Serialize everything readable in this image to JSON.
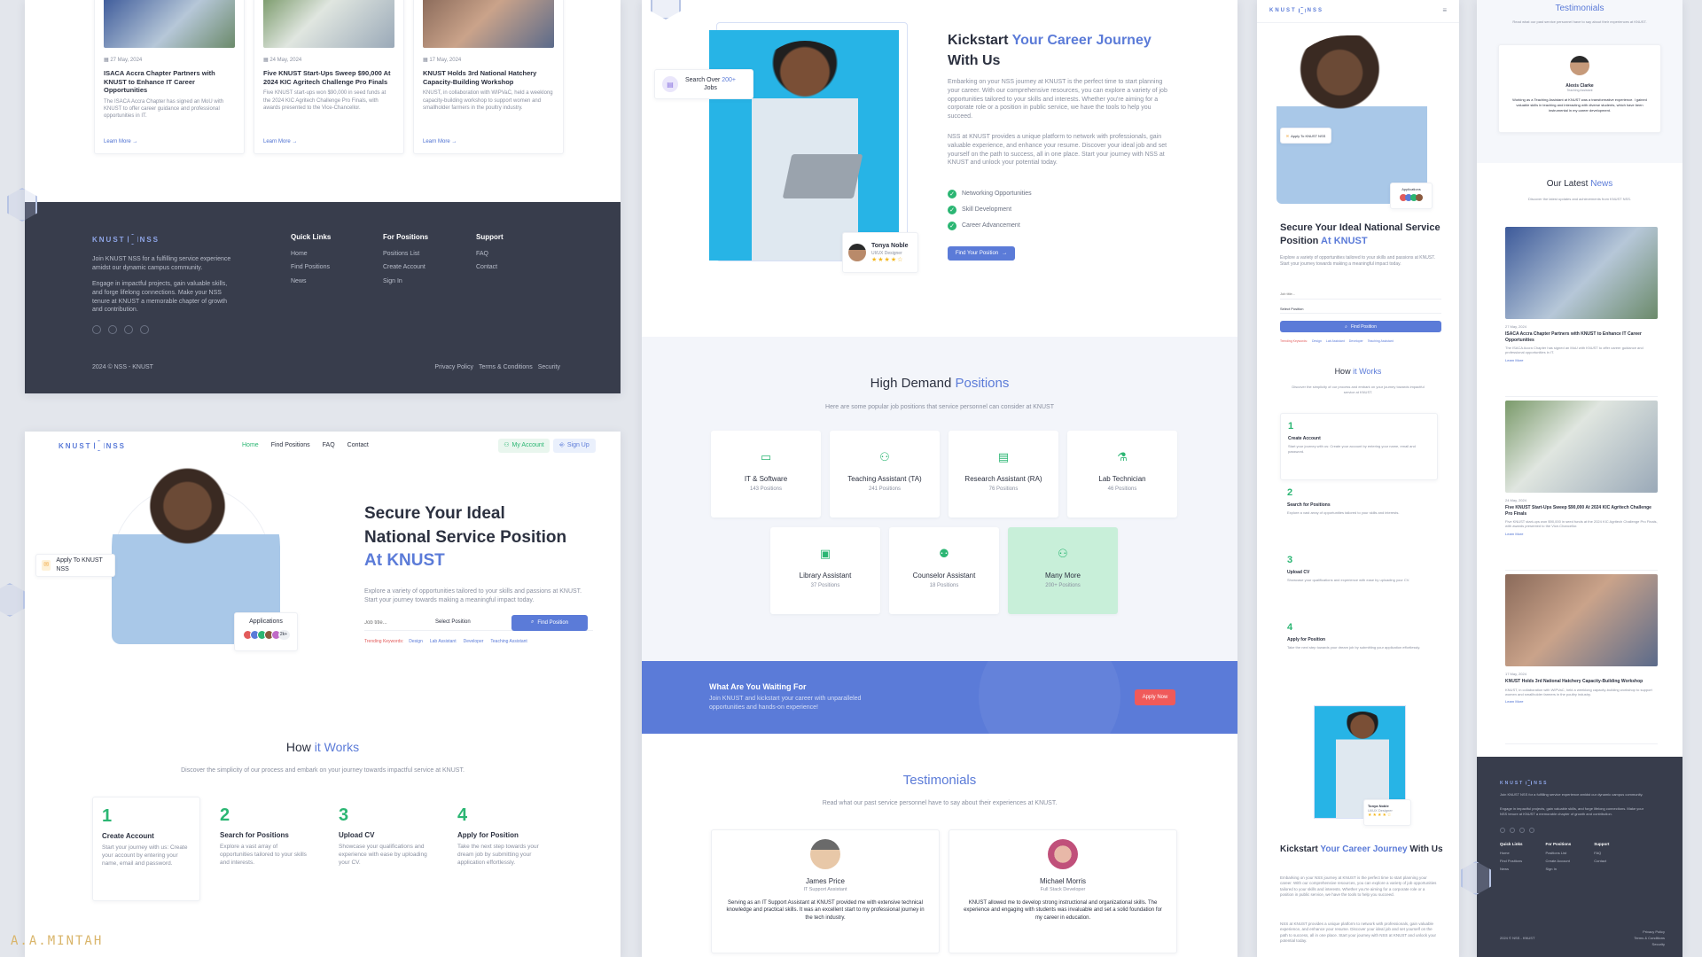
{
  "watermark": "A.A.MINTAH",
  "icons": {
    "calendar": "calendar-icon",
    "arrow": "arrow-right-icon",
    "search": "search-icon",
    "check": "check-icon",
    "star": "star-icon"
  },
  "colors": {
    "accent": "#5b7bd8",
    "footer": "#383d4c",
    "green": "#2bb673",
    "cta": "#5b7bd8",
    "apply_btn": "#f05a5a"
  },
  "news": {
    "title_plain": "Our Latest ",
    "title_accent": "News",
    "subtitle": "Discover the latest updates and achievements from KNUST NSS.",
    "read_more": "Learn More",
    "items": [
      {
        "date": "27 May, 2024",
        "title": "ISACA Accra Chapter Partners with KNUST to Enhance IT Career Opportunities",
        "excerpt": "The ISACA Accra Chapter has signed an MoU with KNUST to offer career guidance and professional opportunities in IT."
      },
      {
        "date": "24 May, 2024",
        "title": "Five KNUST Start-Ups Sweep $90,000 At 2024 KIC Agritech Challenge Pro Finals",
        "excerpt": "Five KNUST start-ups won $90,000 in seed funds at the 2024 KIC Agritech Challenge Pro Finals, with awards presented to the Vice-Chancellor."
      },
      {
        "date": "17 May, 2024",
        "title": "KNUST Holds 3rd National Hatchery Capacity-Building Workshop",
        "excerpt": "KNUST, in collaboration with WIPVaC, held a weeklong capacity-building workshop to support women and smallholder farmers in the poultry industry."
      }
    ]
  },
  "footer": {
    "brand": "KNUST",
    "brand_suffix": "NSS",
    "about1": "Join KNUST NSS for a fulfilling service experience amidst our dynamic campus community.",
    "about2": "Engage in impactful projects, gain valuable skills, and forge lifelong connections. Make your NSS tenure at KNUST a memorable chapter of growth and contribution.",
    "col1_title": "Quick Links",
    "col1": [
      "Home",
      "Find Positions",
      "News"
    ],
    "col2_title": "For Positions",
    "col2": [
      "Positions List",
      "Create Account",
      "Sign In"
    ],
    "col3_title": "Support",
    "col3": [
      "FAQ",
      "Contact"
    ],
    "copyright": "2024 © NSS - KNUST",
    "legal": [
      "Privacy Policy",
      "Terms & Conditions",
      "Security"
    ]
  },
  "nav": {
    "brand": "KNUST",
    "brand_suffix": "NSS",
    "links": [
      "Home",
      "Find Positions",
      "FAQ",
      "Contact"
    ],
    "my_account": "My Account",
    "sign_up": "Sign Up"
  },
  "hero": {
    "title_l1": "Secure Your Ideal",
    "title_l2": "National Service Position",
    "title_accent": "At KNUST",
    "desc": "Explore a variety of opportunities tailored to your skills and passions at KNUST. Start your journey towards making a meaningful impact today.",
    "job_placeholder": "Job title...",
    "select_position": "Select Position",
    "find_btn": "Find Position",
    "trending_label": "Trending Keywords:",
    "trending": [
      "Design",
      "Lab Assistant",
      "Developer",
      "Teaching Assistant"
    ],
    "apply_badge": "Apply To KNUST NSS",
    "applications_label": "Applications",
    "applications_more": "2k+"
  },
  "how": {
    "title_plain": "How ",
    "title_accent": "it Works",
    "subtitle": "Discover the simplicity of our process and embark on your journey towards impactful service at KNUST.",
    "steps": [
      {
        "n": "1",
        "title": "Create Account",
        "desc": "Start your journey with us: Create your account by entering your name, email and password."
      },
      {
        "n": "2",
        "title": "Search for Positions",
        "desc": "Explore a vast array of opportunities tailored to your skills and interests."
      },
      {
        "n": "3",
        "title": "Upload CV",
        "desc": "Showcase your qualifications and experience with ease by uploading your CV."
      },
      {
        "n": "4",
        "title": "Apply for Position",
        "desc": "Take the next step towards your dream job by submitting your application effortlessly."
      }
    ]
  },
  "kickstart": {
    "title_plain": "Kickstart ",
    "title_accent": "Your Career Journey",
    "title_end": "With Us",
    "p1": "Embarking on your NSS journey at KNUST is the perfect time to start planning your career. With our comprehensive resources, you can explore a variety of job opportunities tailored to your skills and interests. Whether you're aiming for a corporate role or a position in public service, we have the tools to help you succeed.",
    "p2": "NSS at KNUST provides a unique platform to network with professionals, gain valuable experience, and enhance your resume. Discover your ideal job and set yourself on the path to success, all in one place. Start your journey with NSS at KNUST and unlock your potential today.",
    "checks": [
      "Networking Opportunities",
      "Skill Development",
      "Career Advancement"
    ],
    "btn": "Find Your Position",
    "search_badge_l1": "Search Over ",
    "search_badge_num": "200+",
    "search_badge_l2": "Jobs",
    "reviewer_name": "Tonya Noble",
    "reviewer_role": "UI/UX Designer",
    "stars": "★★★★☆"
  },
  "positions": {
    "title_plain": "High Demand ",
    "title_accent": "Positions",
    "subtitle": "Here are some popular job positions that service personnel can consider at KNUST",
    "row1": [
      {
        "name": "IT & Software",
        "count": "143 Positions",
        "icon": "laptop-icon",
        "glyph": "▭"
      },
      {
        "name": "Teaching Assistant (TA)",
        "count": "241 Positions",
        "icon": "users-icon",
        "glyph": "⚇"
      },
      {
        "name": "Research Assistant (RA)",
        "count": "76 Positions",
        "icon": "document-icon",
        "glyph": "▤"
      },
      {
        "name": "Lab Technician",
        "count": "46 Positions",
        "icon": "flask-icon",
        "glyph": "⚗"
      }
    ],
    "row2": [
      {
        "name": "Library Assistant",
        "count": "37 Positions",
        "icon": "book-icon",
        "glyph": "▣"
      },
      {
        "name": "Counselor Assistant",
        "count": "18 Positions",
        "icon": "counselor-icon",
        "glyph": "⚉"
      },
      {
        "name": "Many More",
        "count": "200+ Positions",
        "icon": "group-icon",
        "glyph": "⚇"
      }
    ]
  },
  "cta": {
    "title": "What Are You Waiting For",
    "desc": "Join KNUST and kickstart your career with unparalleled opportunities and hands-on experience!",
    "btn": "Apply Now"
  },
  "testimonials": {
    "title": "Testimonials",
    "subtitle": "Read what our past service personnel have to say about their experiences at KNUST.",
    "items": [
      {
        "name": "James Price",
        "role": "IT Support Assistant",
        "quote": "Serving as an IT Support Assistant at KNUST provided me with extensive technical knowledge and practical skills. It was an excellent start to my professional journey in the tech industry."
      },
      {
        "name": "Michael Morris",
        "role": "Full Stack Developer",
        "quote": "KNUST allowed me to develop strong instructional and organizational skills. The experience and engaging with students was invaluable and set a solid foundation for my career in education."
      },
      {
        "name": "Alexis Clarke",
        "role": "Teaching Assistant",
        "quote": "Working as a Teaching Assistant at KNUST was a transformative experience. I gained valuable skills in teaching and interacting with diverse students, which have been instrumental in my career development."
      }
    ]
  },
  "mobile": {
    "hero_title_plain": "Secure Your Ideal National Service Position ",
    "hero_title_accent": "At KNUST",
    "kick_title_plain": "Kickstart ",
    "kick_title_accent": "Your Career Journey",
    "kick_title_end": " With Us"
  }
}
